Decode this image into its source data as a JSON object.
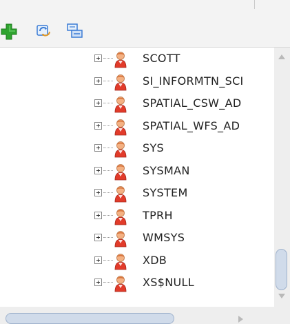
{
  "toolbar": {
    "buttons": [
      {
        "name": "add-user",
        "icon": "plus-icon",
        "color": "#2fa32f"
      },
      {
        "name": "refresh",
        "icon": "refresh-icon",
        "color": "#3a7bd5"
      },
      {
        "name": "filter",
        "icon": "filter-icon",
        "color": "#3a7bd5"
      }
    ]
  },
  "tree": {
    "items": [
      {
        "label": "SCOTT"
      },
      {
        "label": "SI_INFORMTN_SCI"
      },
      {
        "label": "SPATIAL_CSW_AD"
      },
      {
        "label": "SPATIAL_WFS_AD"
      },
      {
        "label": "SYS"
      },
      {
        "label": "SYSMAN"
      },
      {
        "label": "SYSTEM"
      },
      {
        "label": "TPRH"
      },
      {
        "label": "WMSYS"
      },
      {
        "label": "XDB"
      },
      {
        "label": "XS$NULL"
      }
    ]
  },
  "colors": {
    "user_body": "#e23b2a",
    "user_head": "#f4b183",
    "scroll_thumb": "#d0dbea"
  }
}
